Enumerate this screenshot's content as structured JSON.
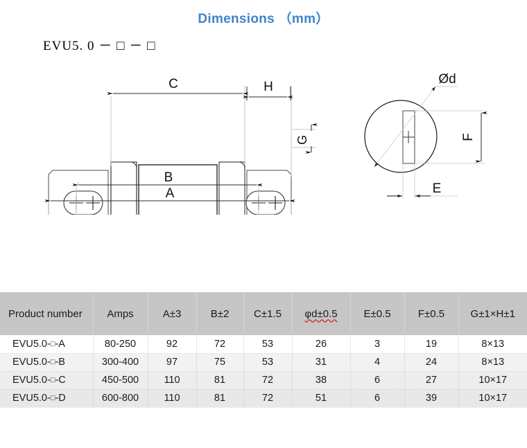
{
  "title": "Dimensions （mm）",
  "part_code": "EVU5. 0 － □ － □",
  "drawing": {
    "labels": {
      "dim_a": "A",
      "dim_b": "B",
      "dim_c": "C",
      "dim_h": "H",
      "dim_g": "G",
      "dim_d": "Ød",
      "dim_e": "E",
      "dim_f": "F"
    },
    "terminal_marks": "++"
  },
  "table": {
    "headers": [
      "Product number",
      "Amps",
      "A±3",
      "B±2",
      "C±1.5",
      "φd±0.5",
      "E±0.5",
      "F±0.5",
      "G±1×H±1"
    ],
    "rows": [
      {
        "product_number_prefix": "EVU5.0-",
        "product_number_box": "□",
        "product_number_suffix": "-A",
        "amps": "80-250",
        "a": "92",
        "b": "72",
        "c": "53",
        "d": "26",
        "e": "3",
        "f": "19",
        "gh": "8×13"
      },
      {
        "product_number_prefix": "EVU5.0-",
        "product_number_box": "□",
        "product_number_suffix": "-B",
        "amps": "300-400",
        "a": "97",
        "b": "75",
        "c": "53",
        "d": "31",
        "e": "4",
        "f": "24",
        "gh": "8×13"
      },
      {
        "product_number_prefix": "EVU5.0-",
        "product_number_box": "□",
        "product_number_suffix": "-C",
        "amps": "450-500",
        "a": "110",
        "b": "81",
        "c": "72",
        "d": "38",
        "e": "6",
        "f": "27",
        "gh": "10×17"
      },
      {
        "product_number_prefix": "EVU5.0-",
        "product_number_box": "□",
        "product_number_suffix": "-D",
        "amps": "600-800",
        "a": "110",
        "b": "81",
        "c": "72",
        "d": "51",
        "e": "6",
        "f": "39",
        "gh": "10×17"
      }
    ]
  },
  "colors": {
    "title": "#3d85c8",
    "header_bg": "#c6c6c6",
    "line": "#1a1a1a",
    "thin_line": "#8a8a8a"
  }
}
